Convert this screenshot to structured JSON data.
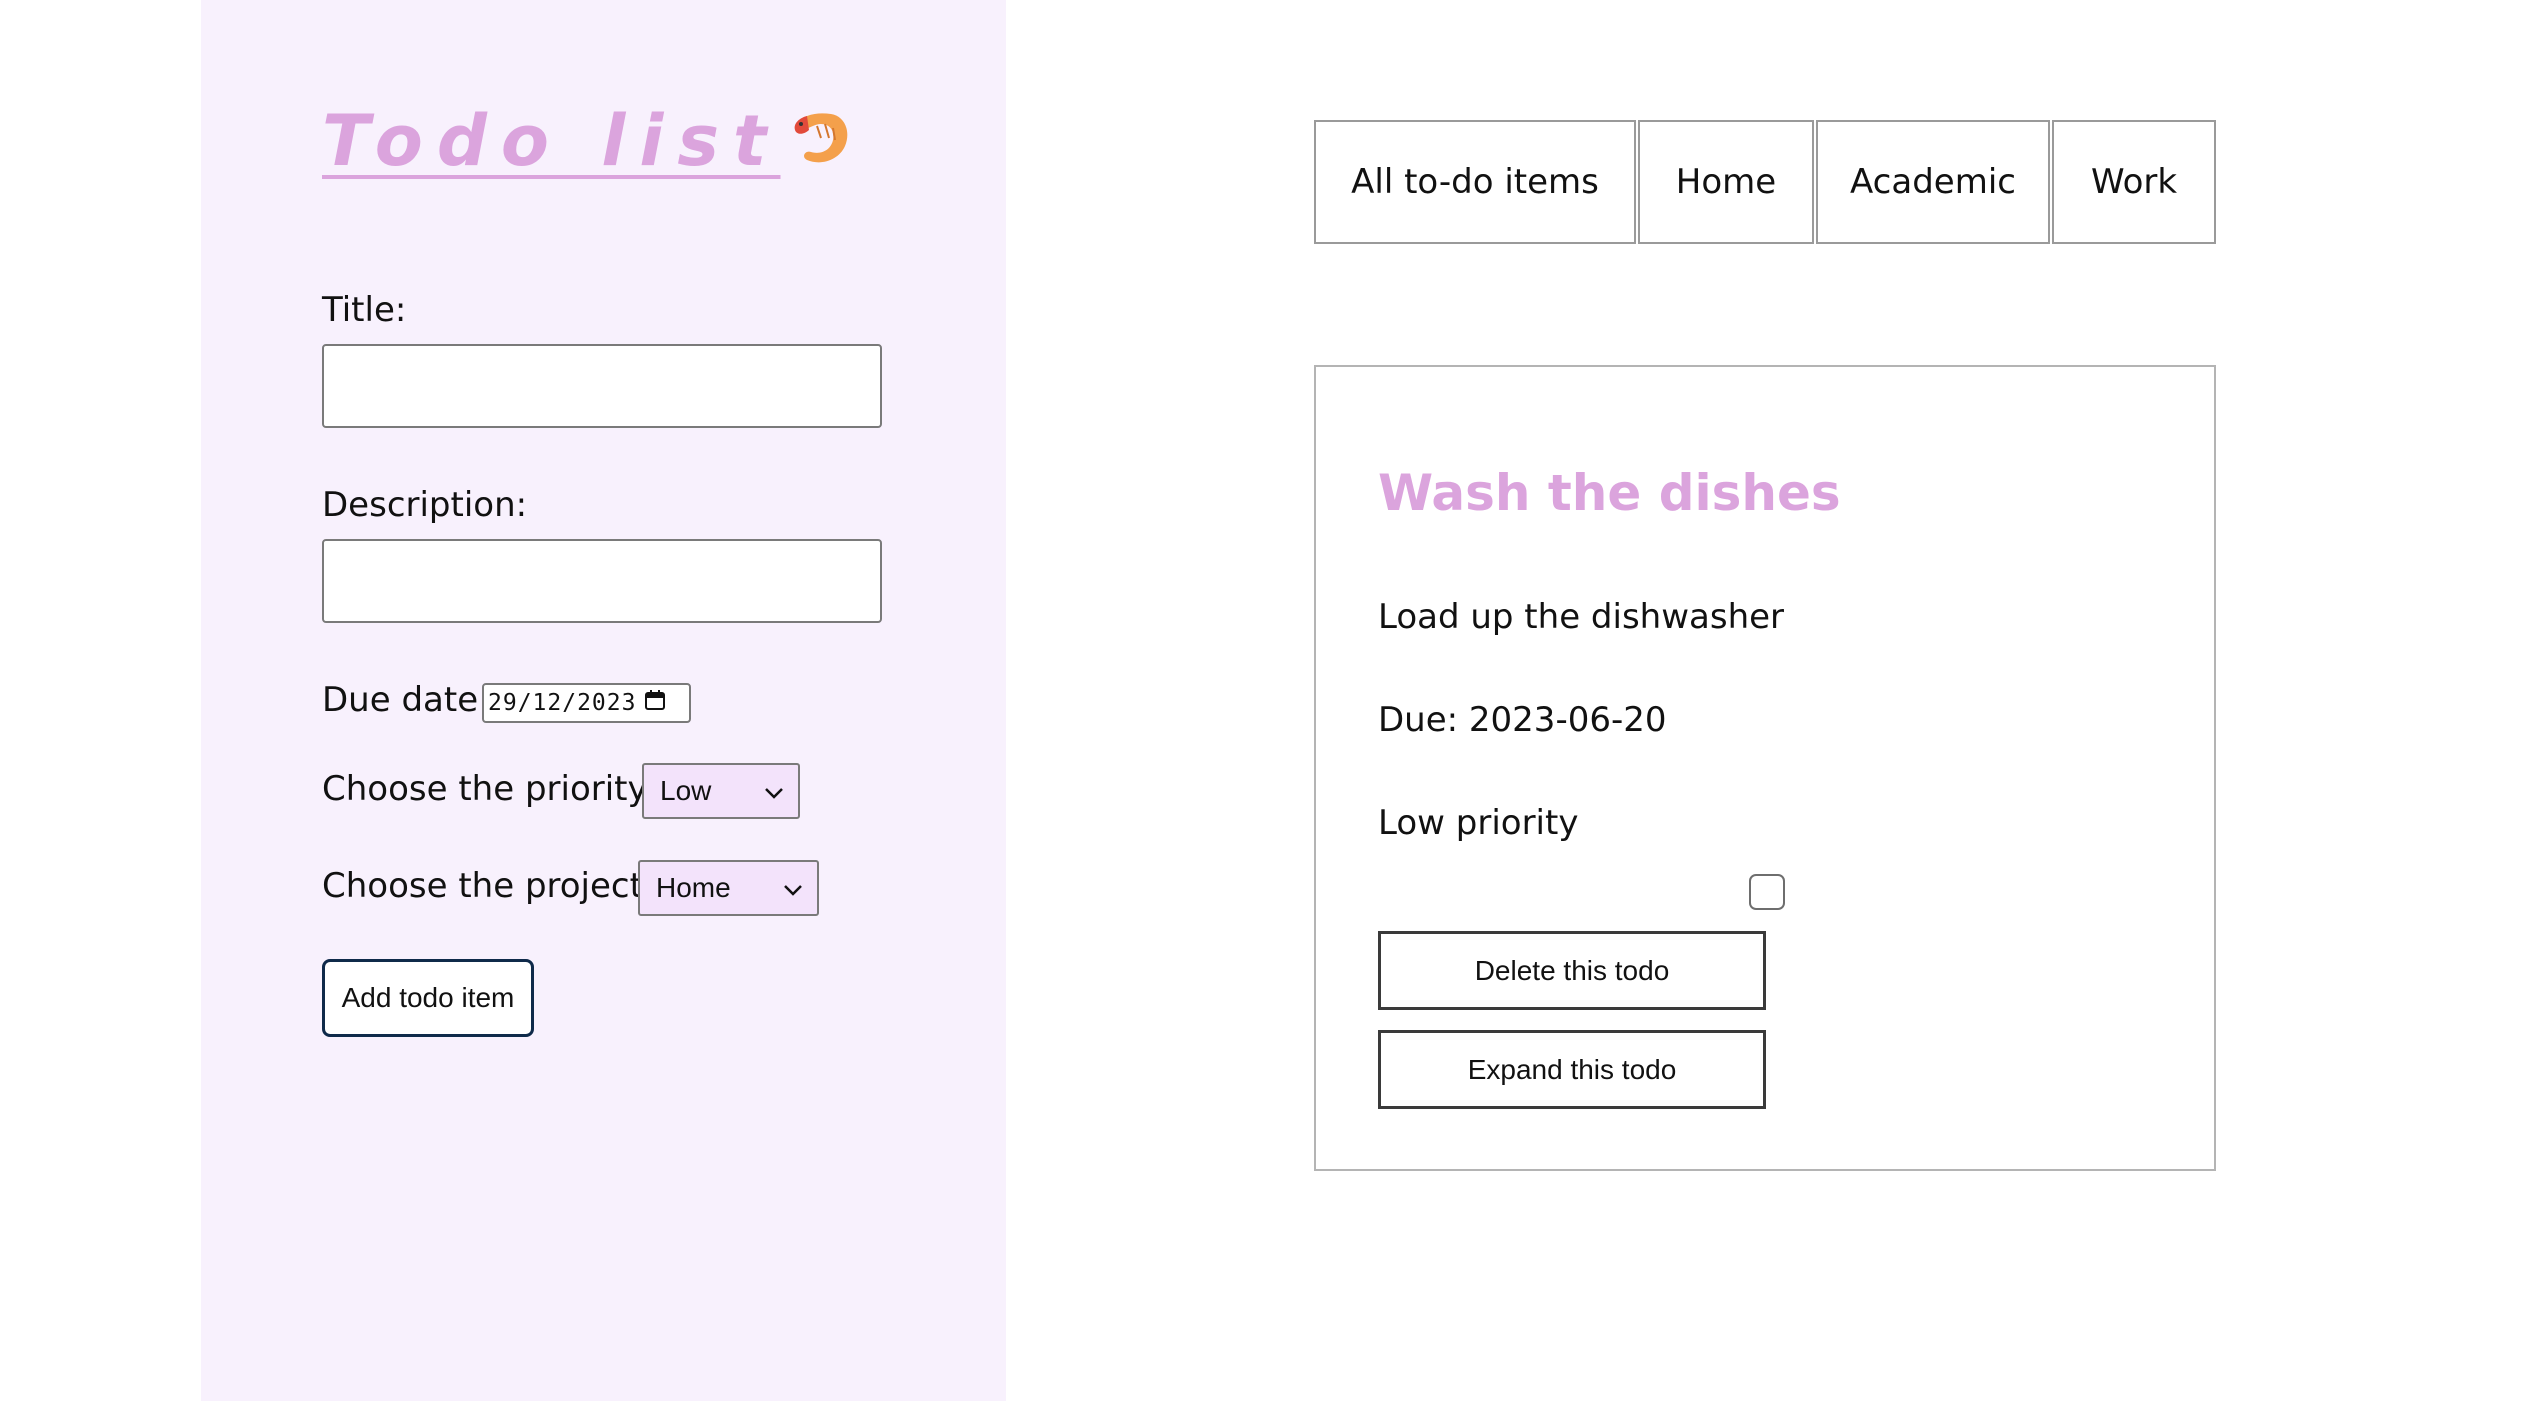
{
  "sidebar": {
    "app_title": "Todo list",
    "form": {
      "title_label": "Title:",
      "title_value": "",
      "description_label": "Description:",
      "description_value": "",
      "due_date_label": "Due date:",
      "due_date_value": "29/12/2023",
      "priority_label": "Choose the priority:",
      "priority_selected": "Low",
      "project_label": "Choose the project:",
      "project_selected": "Home",
      "add_button_label": "Add todo item"
    }
  },
  "projects_nav": {
    "tabs": [
      {
        "label": "All to-do items"
      },
      {
        "label": "Home"
      },
      {
        "label": "Academic"
      },
      {
        "label": "Work"
      }
    ]
  },
  "todos": [
    {
      "title": "Wash the dishes",
      "description": "Load up the dishwasher",
      "due": "Due: 2023-06-20",
      "priority": "Low priority",
      "completed": false,
      "delete_label": "Delete this todo",
      "expand_label": "Expand this todo"
    }
  ],
  "colors": {
    "sidebar_bg": "#f8f1fd",
    "accent_pink": "#dba4dd",
    "select_bg": "#f3e3fb",
    "button_border_navy": "#0f2a4a"
  },
  "icons": {
    "title_emoji": "shrimp-icon",
    "date_picker": "calendar-icon",
    "select_arrow": "chevron-down-icon"
  }
}
